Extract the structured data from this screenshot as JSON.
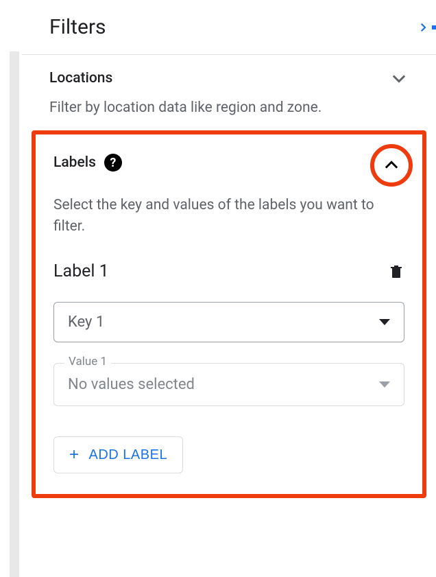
{
  "header": {
    "title": "Filters"
  },
  "sections": {
    "locations": {
      "title": "Locations",
      "subtitle": "Filter by location data like region and zone."
    },
    "labels": {
      "title": "Labels",
      "subtitle": "Select the key and values of the labels you want to filter.",
      "label_entry": {
        "name": "Label 1",
        "key_placeholder": "Key 1",
        "value_label": "Value 1",
        "value_placeholder": "No values selected"
      },
      "add_label_button": "ADD LABEL"
    }
  }
}
